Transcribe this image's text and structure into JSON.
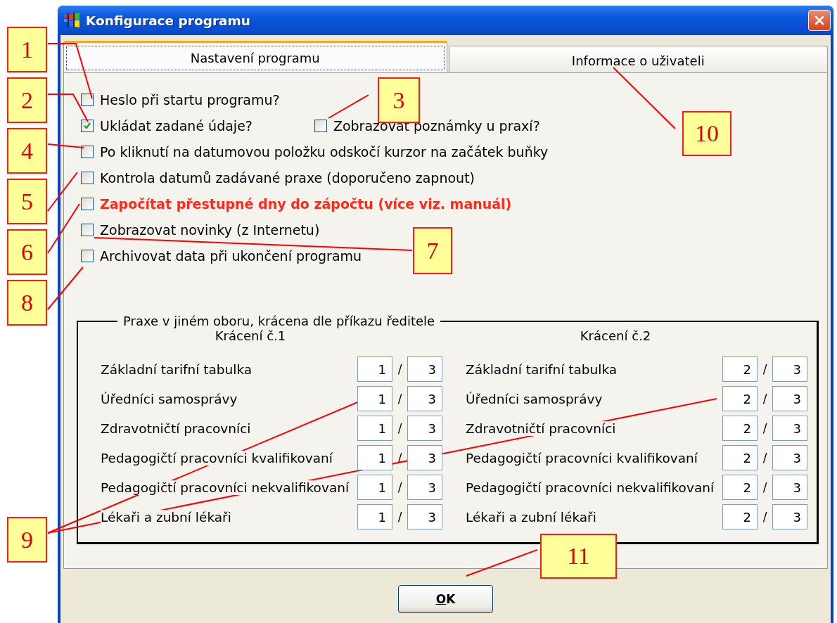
{
  "window": {
    "title": "Konfigurace programu"
  },
  "tabs": [
    {
      "label": "Nastavení programu",
      "selected": true
    },
    {
      "label": "Informace o uživateli",
      "selected": false
    }
  ],
  "option_rows": [
    {
      "items": [
        {
          "label": "Heslo při startu programu?",
          "checked": false,
          "kind": "plain"
        }
      ]
    },
    {
      "items": [
        {
          "label": "Ukládat zadané údaje?",
          "checked": true,
          "kind": "plain"
        },
        {
          "label": "Zobrazovat poznámky u praxí?",
          "checked": false,
          "kind": "plain"
        }
      ]
    },
    {
      "items": [
        {
          "label": "Po kliknutí na datumovou položku odskočí kurzor na začátek buňky",
          "checked": false,
          "kind": "plain"
        }
      ]
    },
    {
      "items": [
        {
          "label": "Kontrola datumů zadávané praxe (doporučeno zapnout)",
          "checked": false,
          "kind": "plain"
        }
      ]
    },
    {
      "items": [
        {
          "label": "Započítat přestupné dny do zápočtu (více viz. manuál)",
          "checked": false,
          "kind": "warning"
        }
      ]
    },
    {
      "items": [
        {
          "label": "Zobrazovat novinky (z Internetu)",
          "checked": false,
          "kind": "plain"
        }
      ]
    },
    {
      "items": [
        {
          "label": "Archivovat data při ukončení programu",
          "checked": false,
          "kind": "plain"
        }
      ]
    }
  ],
  "shortening": {
    "title": "Praxe v jiném oboru, krácena dle příkazu ředitele",
    "columns": [
      {
        "heading": "Krácení č.1",
        "rows": [
          {
            "label": "Základní tarifní tabulka",
            "numerator": "1",
            "separator": "/",
            "denominator": "3"
          },
          {
            "label": "Úředníci samosprávy",
            "numerator": "1",
            "separator": "/",
            "denominator": "3"
          },
          {
            "label": "Zdravotničtí pracovníci",
            "numerator": "1",
            "separator": "/",
            "denominator": "3"
          },
          {
            "label": "Pedagogičtí pracovníci kvalifikovaní",
            "numerator": "1",
            "separator": "/",
            "denominator": "3"
          },
          {
            "label": "Pedagogičtí pracovníci nekvalifikovaní",
            "numerator": "1",
            "separator": "/",
            "denominator": "3"
          },
          {
            "label": "Lékaři a zubní lékaři",
            "numerator": "1",
            "separator": "/",
            "denominator": "3"
          }
        ]
      },
      {
        "heading": "Krácení č.2",
        "rows": [
          {
            "label": "Základní tarifní tabulka",
            "numerator": "2",
            "separator": "/",
            "denominator": "3"
          },
          {
            "label": "Úředníci samosprávy",
            "numerator": "2",
            "separator": "/",
            "denominator": "3"
          },
          {
            "label": "Zdravotničtí pracovníci",
            "numerator": "2",
            "separator": "/",
            "denominator": "3"
          },
          {
            "label": "Pedagogičtí pracovníci kvalifikovaní",
            "numerator": "2",
            "separator": "/",
            "denominator": "3"
          },
          {
            "label": "Pedagogičtí pracovníci nekvalifikovaní",
            "numerator": "2",
            "separator": "/",
            "denominator": "3"
          },
          {
            "label": "Lékaři a zubní lékaři",
            "numerator": "2",
            "separator": "/",
            "denominator": "3"
          }
        ]
      }
    ]
  },
  "ok_button": {
    "label": "OK"
  },
  "callouts": [
    {
      "label": "1"
    },
    {
      "label": "2"
    },
    {
      "label": "3"
    },
    {
      "label": "4"
    },
    {
      "label": "5"
    },
    {
      "label": "6"
    },
    {
      "label": "7"
    },
    {
      "label": "8"
    },
    {
      "label": "9"
    },
    {
      "label": "10"
    },
    {
      "label": "11"
    }
  ]
}
